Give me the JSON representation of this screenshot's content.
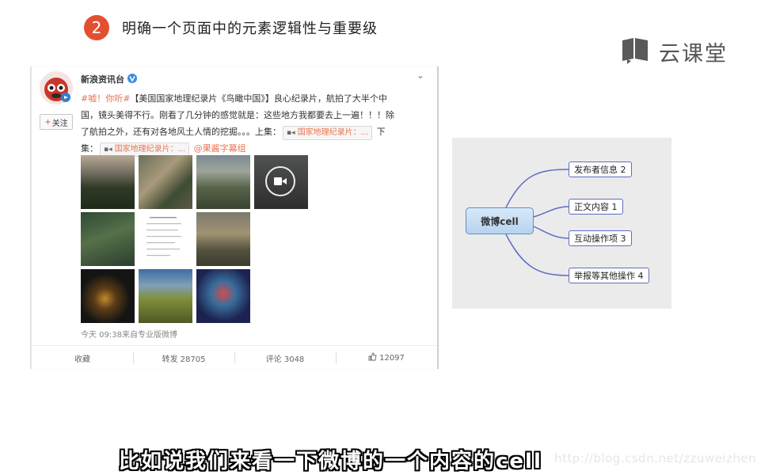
{
  "slide": {
    "step_number": "2",
    "title": "明确一个页面中的元素逻辑性与重要级"
  },
  "brand": {
    "name": "云课堂",
    "icon": "book-icon",
    "color": "#555555"
  },
  "weibo_post": {
    "user_name": "新浪资讯台",
    "verified_icon": "verified-v-icon",
    "follow_label": "关注",
    "text": {
      "hashtag": "#嘘！你听#",
      "line_1": "【美国国家地理纪录片《鸟瞰中国》】良心纪录片，航拍了大半个中",
      "line_2": "国，镜头美得不行。刚看了几分钟的感觉就是：这些地方我都要去上一遍！！！除",
      "line_3": "了航拍之外，还有对各地风土人情的挖掘。。。上集：",
      "link_1": "国家地理纪录片：...",
      "next_label": "下",
      "line_4": "集：",
      "link_2": "国家地理纪录片：...",
      "mention": "@果酱字幕组"
    },
    "meta": "今天 09:38来自专业版微博",
    "actions": {
      "favorite": "收藏",
      "repost": "转发 28705",
      "comment": "评论 3048",
      "like": "12097"
    },
    "accent_color": "#eb7350"
  },
  "mind_map": {
    "root": "微博cell",
    "nodes": [
      {
        "label": "发布者信息 2"
      },
      {
        "label": "正文内容 1"
      },
      {
        "label": "互动操作项 3"
      },
      {
        "label": "举报等其他操作 4"
      }
    ],
    "line_color": "#5d6dc4"
  },
  "subtitle": "比如说我们来看一下微博的一个内容的cell",
  "watermark": "http://blog.csdn.net/zzuweizheng",
  "colors": {
    "badge": "#e2502f"
  }
}
